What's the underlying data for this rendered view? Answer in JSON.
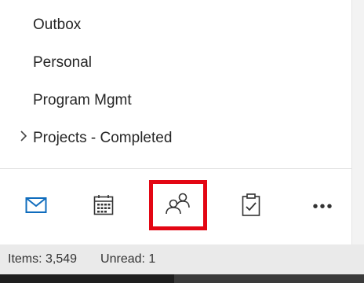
{
  "folders": [
    {
      "label": "Outbox",
      "expandable": false
    },
    {
      "label": "Personal",
      "expandable": false
    },
    {
      "label": "Program Mgmt",
      "expandable": false
    },
    {
      "label": "Projects - Completed",
      "expandable": true
    }
  ],
  "nav": {
    "mail_icon": "mail-icon",
    "calendar_icon": "calendar-icon",
    "people_icon": "people-icon",
    "tasks_icon": "tasks-icon",
    "more_icon": "more-icon",
    "more_label": "•••"
  },
  "status": {
    "items": "Items: 3,549",
    "unread": "Unread: 1"
  },
  "colors": {
    "accent": "#0f6cbd",
    "highlight": "#e30613",
    "icon": "#333333",
    "status_bg": "#eaeaea"
  }
}
